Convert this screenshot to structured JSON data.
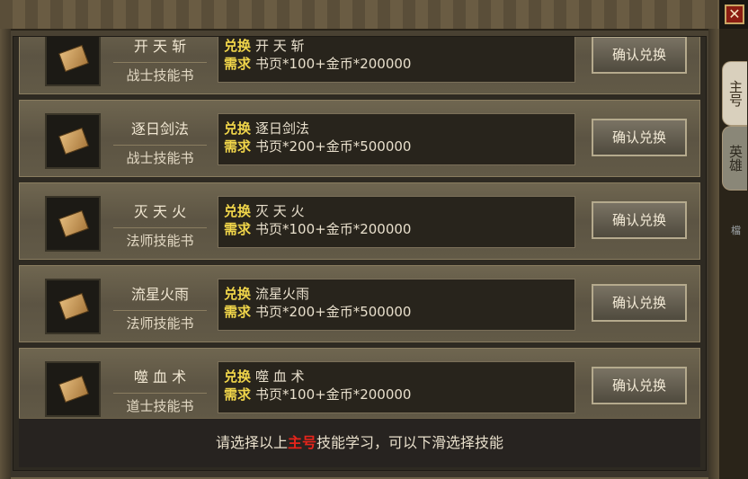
{
  "window": {
    "close_symbol": "✕"
  },
  "tabs": {
    "main": "主号",
    "hero": "英雄"
  },
  "edge_text": "檔",
  "labels": {
    "exchange": "兑换",
    "require": "需求"
  },
  "rows": [
    {
      "name": "开 天 斩",
      "type": "战士技能书",
      "exchange": "开 天 斩",
      "require": "书页*100+金币*200000",
      "button": "确认兑换"
    },
    {
      "name": "逐日剑法",
      "type": "战士技能书",
      "exchange": "逐日剑法",
      "require": "书页*200+金币*500000",
      "button": "确认兑换"
    },
    {
      "name": "灭 天 火",
      "type": "法师技能书",
      "exchange": "灭 天 火",
      "require": "书页*100+金币*200000",
      "button": "确认兑换"
    },
    {
      "name": "流星火雨",
      "type": "法师技能书",
      "exchange": "流星火雨",
      "require": "书页*200+金币*500000",
      "button": "确认兑换"
    },
    {
      "name": "噬 血 术",
      "type": "道士技能书",
      "exchange": "噬 血 术",
      "require": "书页*100+金币*200000",
      "button": "确认兑换"
    }
  ],
  "hint": {
    "before": "请选择以上",
    "highlight": "主号",
    "after": "技能学习，可以下滑选择技能"
  },
  "colors": {
    "highlight": "#e5241b",
    "key_label": "#f0d54a"
  }
}
